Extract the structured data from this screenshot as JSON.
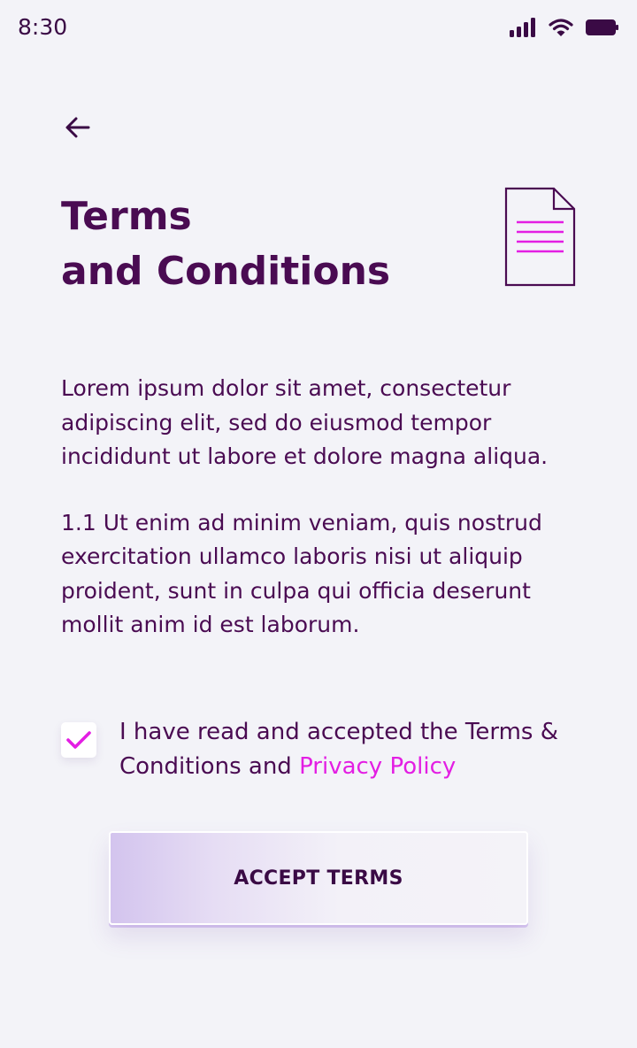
{
  "status_bar": {
    "time": "8:30",
    "icons": [
      "signal-icon",
      "wifi-icon",
      "battery-icon"
    ]
  },
  "header": {
    "back_icon": "arrow-left-icon",
    "title_line1": "Terms",
    "title_line2": "and Conditions",
    "document_icon": "document-icon"
  },
  "terms": {
    "paragraph1": "Lorem ipsum dolor sit amet, consectetur adipiscing elit, sed do eiusmod tempor incididunt ut labore et dolore magna aliqua.",
    "paragraph2": "1.1 Ut enim ad minim veniam, quis nostrud exercitation ullamco laboris nisi ut aliquip proident, sunt in culpa qui officia deserunt mollit anim id est laborum."
  },
  "acceptance": {
    "checked": true,
    "text": "I have read and accepted the Terms & Conditions and ",
    "link_text": "Privacy Policy"
  },
  "button": {
    "label": "ACCEPT TERMS"
  },
  "colors": {
    "background": "#f3f3f8",
    "primary_text": "#4a0b52",
    "accent": "#e31ee3",
    "button_gradient_start": "#d3c4ee"
  }
}
